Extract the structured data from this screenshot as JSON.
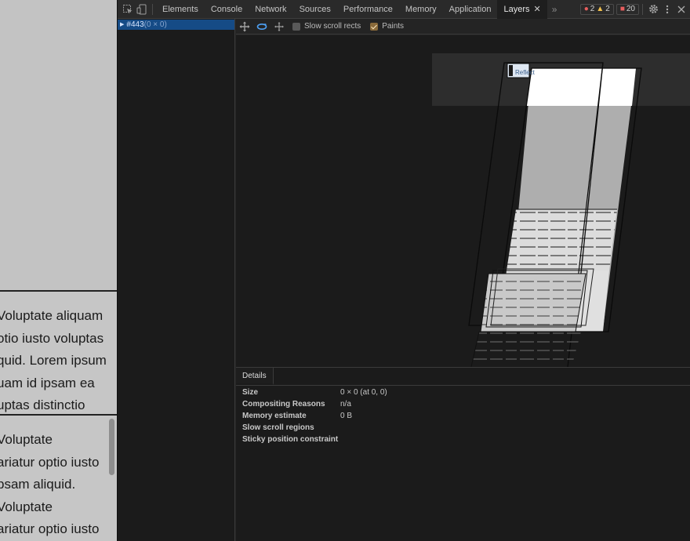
{
  "page": {
    "box2_lines": [
      "Voluptate aliquam",
      "otio iusto voluptas",
      "quid. Lorem ipsum",
      "uam id ipsam ea",
      "uptas distinctio"
    ],
    "box3_lines": [
      "Voluptate",
      "ariatur optio iusto",
      "psam aliquid.",
      "Voluptate",
      "ariatur optio iusto"
    ]
  },
  "devtools": {
    "tabs": [
      "Elements",
      "Console",
      "Network",
      "Sources",
      "Performance",
      "Memory",
      "Application",
      "Layers"
    ],
    "active_tab": "Layers",
    "more_tabs_glyph": "»",
    "errors": "2",
    "warnings": "2",
    "issues": "20",
    "icons": {
      "inspect": "inspect-element-icon",
      "device": "device-toolbar-icon",
      "settings": "gear-icon",
      "menu": "kebab-menu-icon",
      "close": "close-icon"
    },
    "colors": {
      "selection": "#154b86",
      "error": "#e85e5e",
      "warning": "#f2c14e"
    }
  },
  "layer_tree": {
    "selected": {
      "id": "#443",
      "size": "(0 × 0)"
    }
  },
  "layers_toolbar": {
    "tools": [
      "pan-mode-icon",
      "rotate-mode-icon",
      "reset-view-icon"
    ],
    "slow_scroll_label": "Slow scroll rects",
    "slow_scroll_checked": false,
    "paints_label": "Paints",
    "paints_checked": true
  },
  "viewport": {
    "layer_label": "Reflect",
    "icons": {
      "layer_badge": "layer-badge-icon"
    }
  },
  "details": {
    "tab_label": "Details",
    "rows": [
      {
        "key": "Size",
        "value": "0 × 0 (at 0, 0)"
      },
      {
        "key": "Compositing Reasons",
        "value": "n/a"
      },
      {
        "key": "Memory estimate",
        "value": "0 B"
      },
      {
        "key": "Slow scroll regions",
        "value": ""
      },
      {
        "key": "Sticky position constraint",
        "value": ""
      }
    ]
  }
}
